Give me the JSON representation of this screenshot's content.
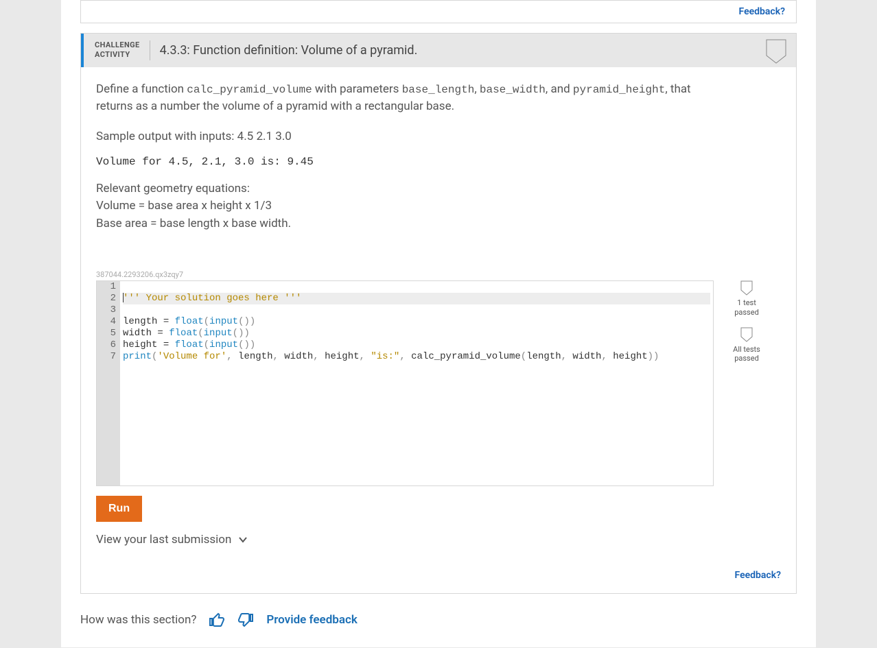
{
  "top_feedback_link": "Feedback?",
  "challenge": {
    "label_line1": "CHALLENGE",
    "label_line2": "ACTIVITY",
    "title": "4.3.3: Function definition: Volume of a pyramid.",
    "prompt_pre": "Define a function ",
    "func_name": "calc_pyramid_volume",
    "prompt_mid1": " with parameters ",
    "param1": "base_length",
    "sep1": ", ",
    "param2": "base_width",
    "sep2": ", and ",
    "param3": "pyramid_height",
    "prompt_post": ", that returns as a number the volume of a pyramid with a rectangular base.",
    "sample_label": "Sample output with inputs: 4.5 2.1 3.0",
    "sample_output": "Volume for 4.5, 2.1, 3.0 is: 9.45",
    "geo_header": "Relevant geometry equations:",
    "geo_line1": "Volume = base area x height x 1/3",
    "geo_line2": "Base area = base length x base width."
  },
  "hash": "387044.2293206.qx3zqy7",
  "code": {
    "lines": [
      {
        "n": 1,
        "type": "blank"
      },
      {
        "n": 2,
        "type": "comment",
        "text": "''' Your solution goes here '''"
      },
      {
        "n": 3,
        "type": "blank"
      },
      {
        "n": 4,
        "type": "assign",
        "var": "length",
        "raw": " = float(input())"
      },
      {
        "n": 5,
        "type": "assign",
        "var": "width",
        "raw": " = float(input())"
      },
      {
        "n": 6,
        "type": "assign",
        "var": "height",
        "raw": " = float(input())"
      },
      {
        "n": 7,
        "type": "print",
        "raw": "print('Volume for', length, width, height, \"is:\", calc_pyramid_volume(length, width, height))"
      }
    ]
  },
  "status": {
    "one_test": "1 test\npassed",
    "all_tests": "All tests\npassed"
  },
  "run_label": "Run",
  "view_last": "View your last submission",
  "footer_feedback": "Feedback?",
  "section_feedback": {
    "question": "How was this section?",
    "provide": "Provide feedback"
  }
}
